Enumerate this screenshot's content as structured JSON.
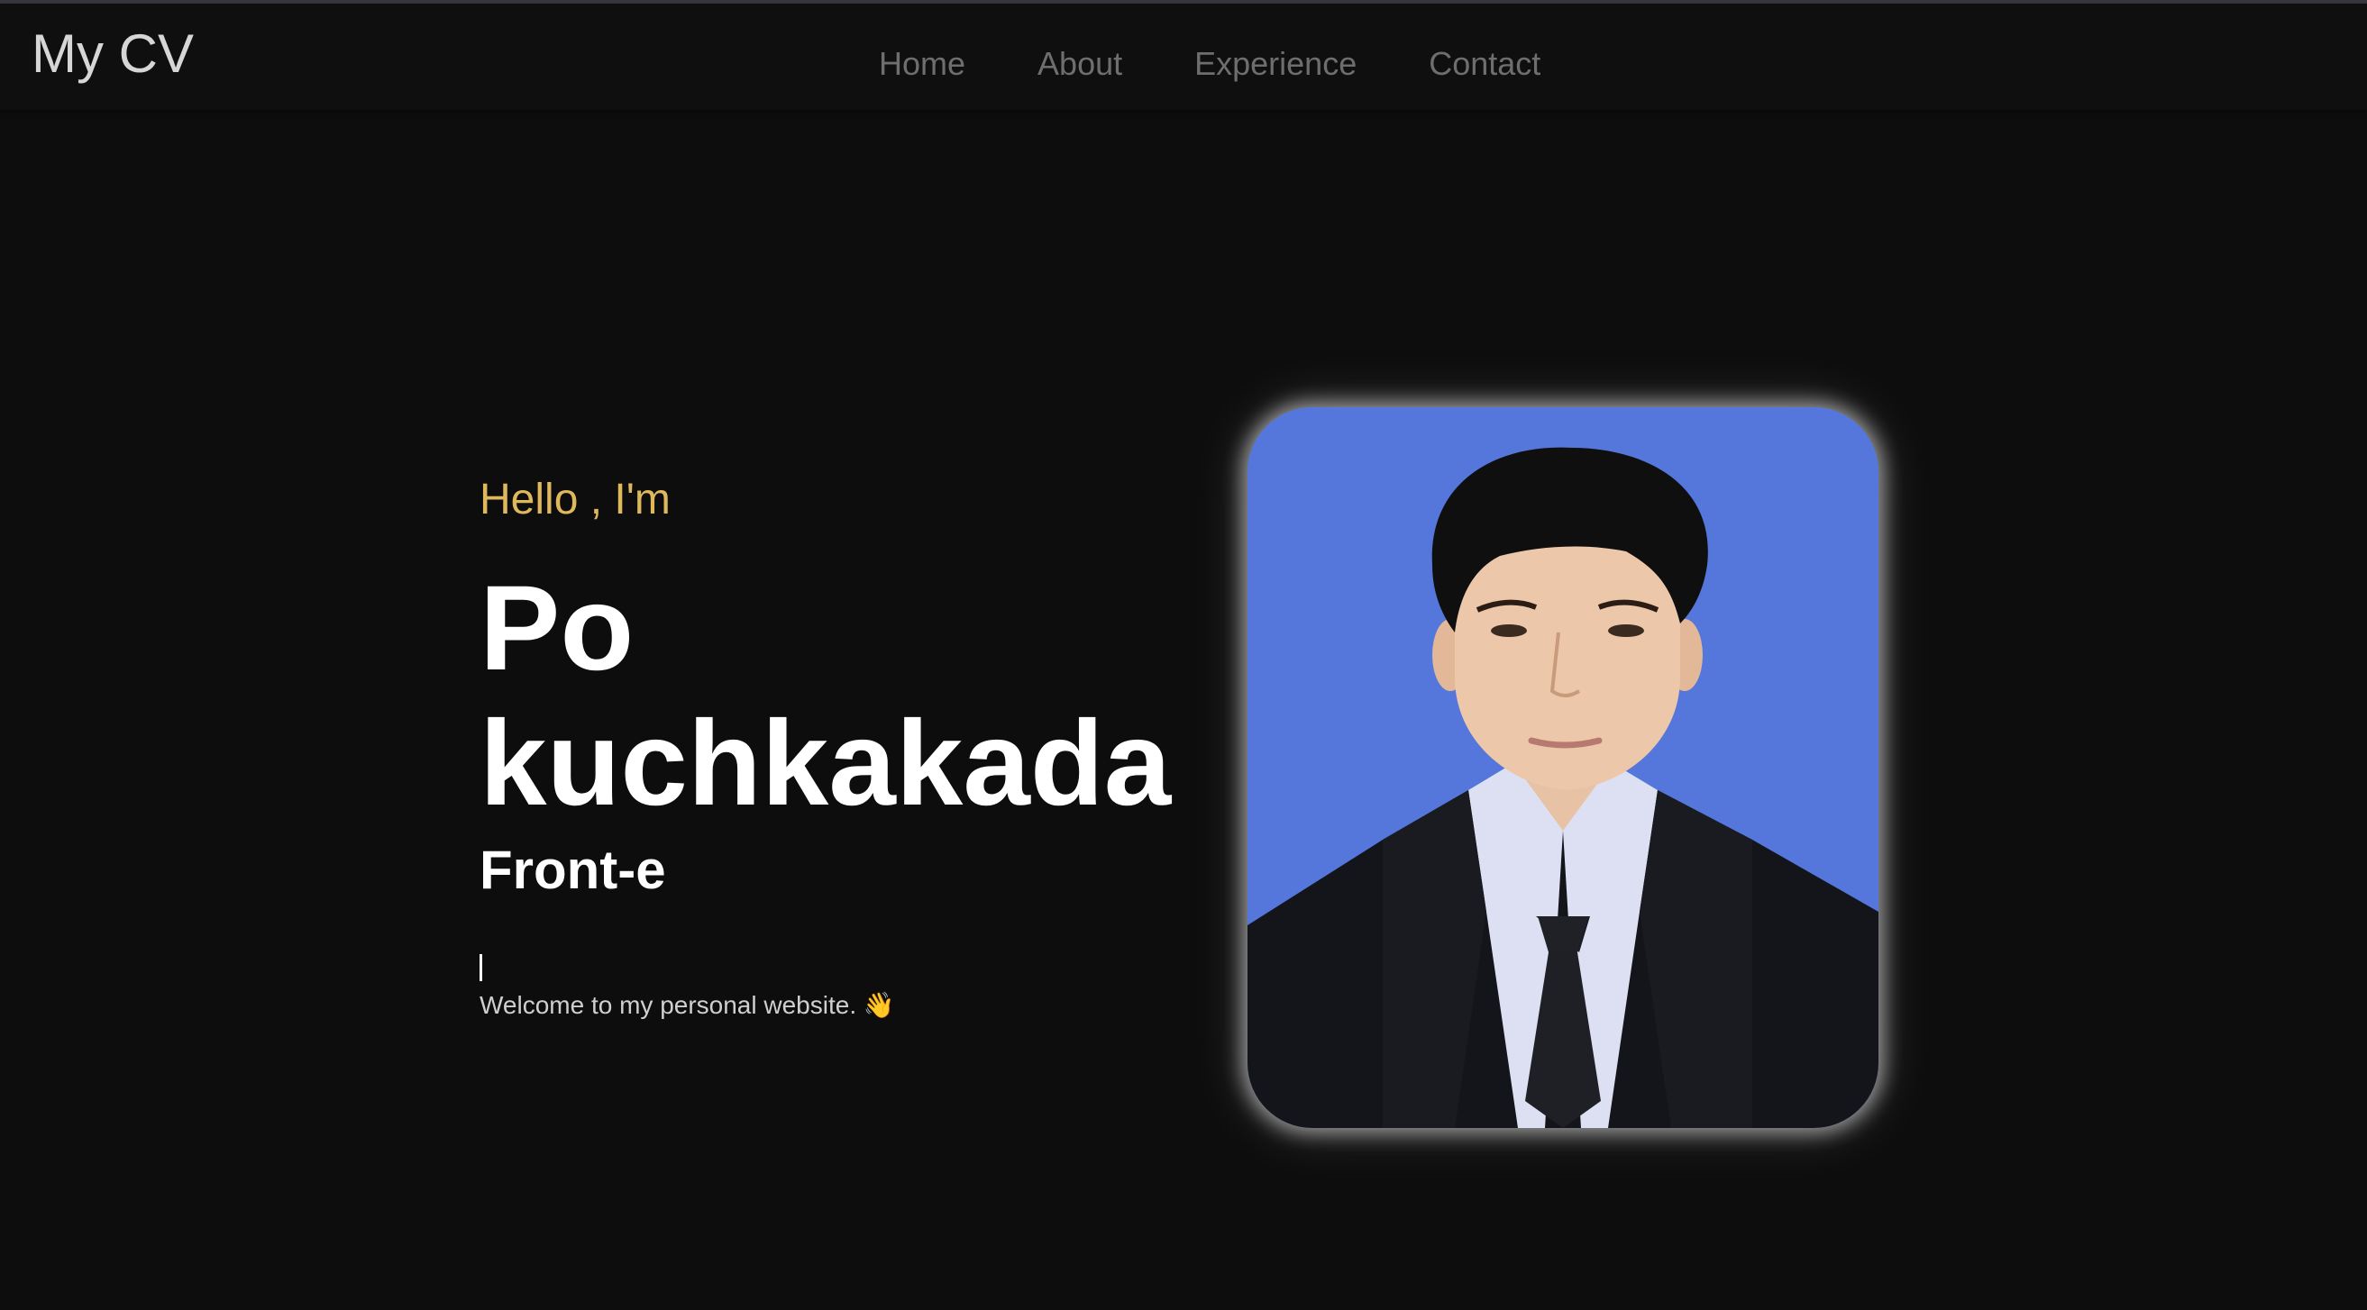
{
  "brand": "My CV",
  "nav": {
    "items": [
      {
        "label": "Home"
      },
      {
        "label": "About"
      },
      {
        "label": "Experience"
      },
      {
        "label": "Contact"
      }
    ]
  },
  "hero": {
    "greeting": "Hello , I'm",
    "name_line1": "Po",
    "name_line2": "kuchkakada",
    "role": "Front-e",
    "welcome": "Welcome to my personal website. 👋"
  },
  "colors": {
    "background": "#0d0d0d",
    "accent": "#e0b85c",
    "nav_text": "#6e6e6e",
    "photo_background": "#5577db"
  }
}
